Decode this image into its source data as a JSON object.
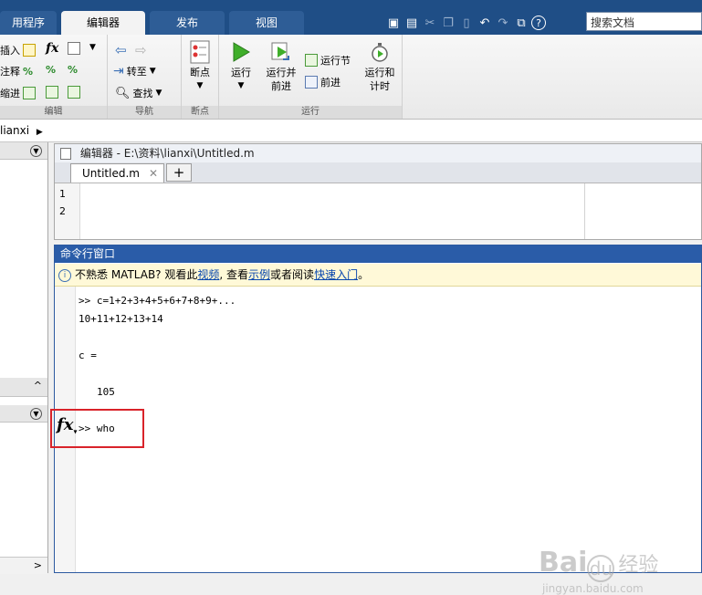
{
  "tabs": {
    "apps": "用程序",
    "editor": "编辑器",
    "publish": "发布",
    "view": "视图"
  },
  "search": {
    "placeholder": "搜索文档"
  },
  "ribbon": {
    "edit": {
      "insert": "插入",
      "comment": "注释",
      "indent": "缩进",
      "label": "编辑"
    },
    "nav": {
      "goto": "转至",
      "find": "查找",
      "label": "导航"
    },
    "breakpoints": {
      "button": "断点",
      "label": "断点"
    },
    "run": {
      "run": "运行",
      "run_advance_1": "运行并",
      "run_advance_2": "前进",
      "run_section": "运行节",
      "advance": "前进",
      "run_time_1": "运行和",
      "run_time_2": "计时",
      "label": "运行"
    }
  },
  "path": {
    "folder": "lianxi"
  },
  "editor": {
    "title": "编辑器 - E:\\资料\\lianxi\\Untitled.m",
    "tab": "Untitled.m",
    "lines": [
      "1",
      "2"
    ]
  },
  "command": {
    "title": "命令行窗口",
    "info_prefix": "不熟悉 MATLAB? 观看此",
    "info_link1": "视频",
    "info_mid1": ", 查看",
    "info_link2": "示例",
    "info_mid2": "或者阅读",
    "info_link3": "快速入门",
    "info_suffix": "。",
    "line1": ">> c=1+2+3+4+5+6+7+8+9+...",
    "line2": "10+11+12+13+14",
    "line3": "c =",
    "line4": "105",
    "prompt": ">> who"
  },
  "watermark": {
    "brand": "Bai",
    "brand2": "du",
    "brand3": "经验",
    "url": "jingyan.baidu.com"
  },
  "colors": {
    "tab_bar": "#1f4e86",
    "cmd_title": "#2a5ca8",
    "highlight_box": "#d9232a",
    "info_bar": "#fff9d8"
  }
}
